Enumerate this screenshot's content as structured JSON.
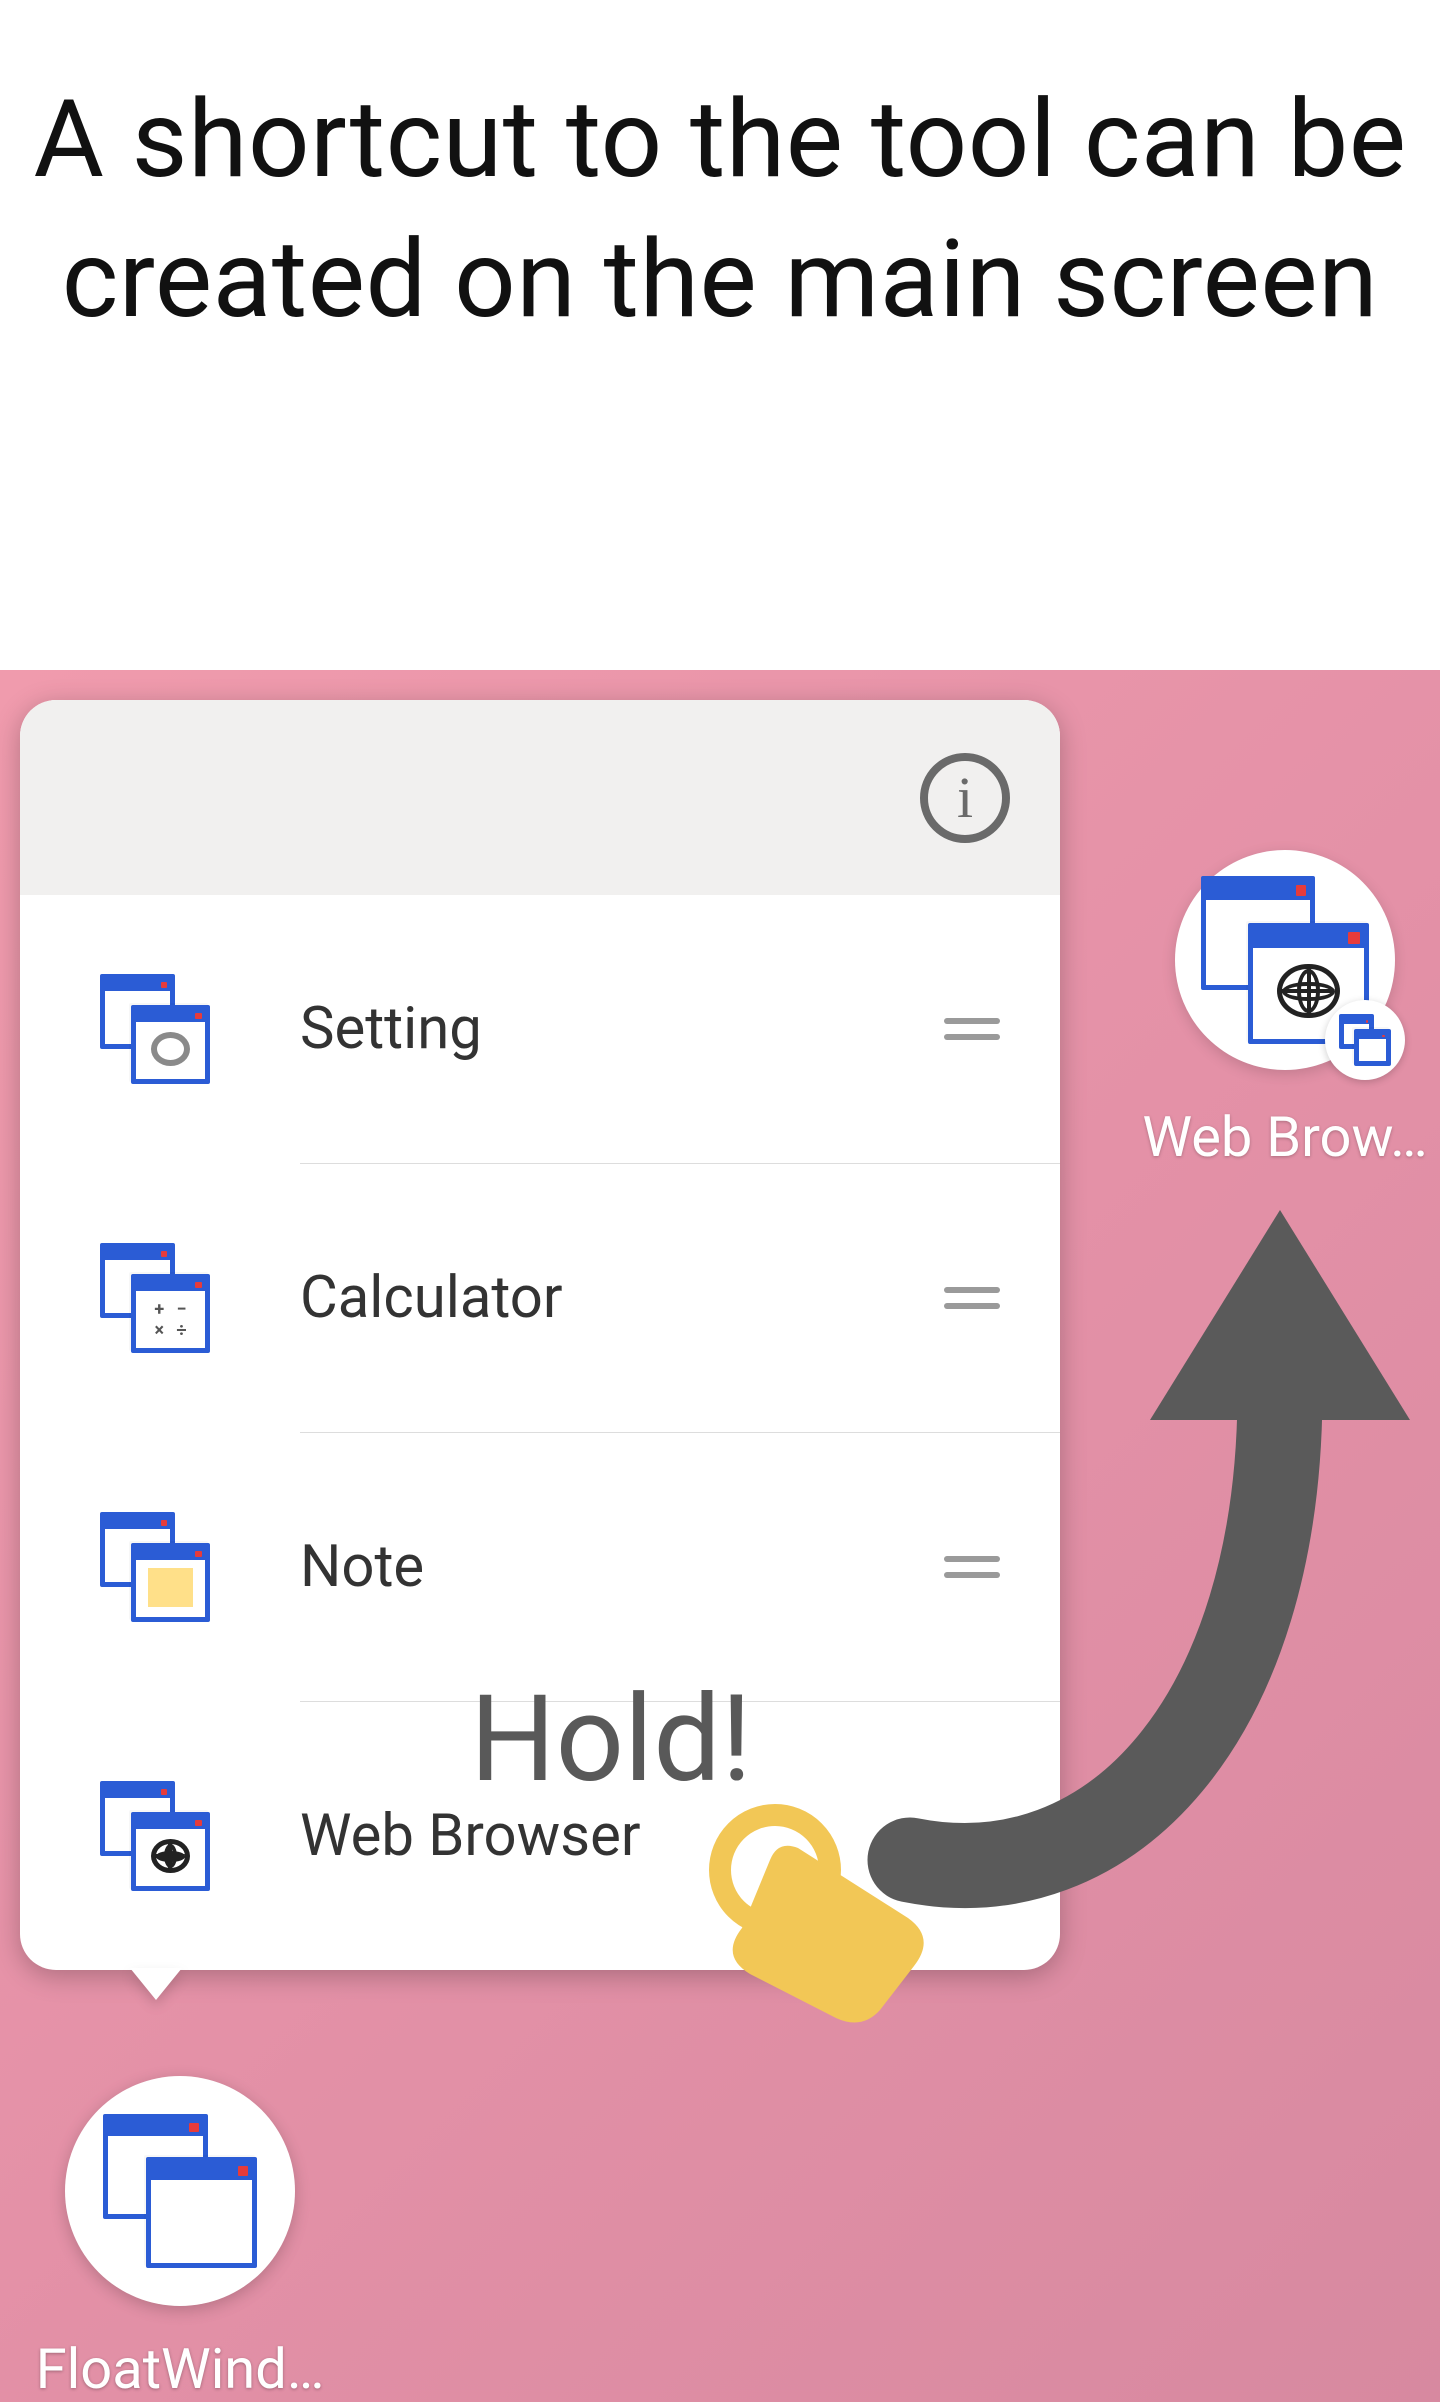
{
  "caption": "A shortcut to the tool can be created on the main screen",
  "panel": {
    "items": [
      {
        "label": "Setting",
        "glyph": "gear"
      },
      {
        "label": "Calculator",
        "glyph": "calc"
      },
      {
        "label": "Note",
        "glyph": "note"
      },
      {
        "label": "Web Browser",
        "glyph": "globe"
      }
    ]
  },
  "overlay": {
    "hold_label": "Hold!"
  },
  "shortcuts": {
    "browser_label": "Web Brow…",
    "float_label": "FloatWind…"
  },
  "info_char": "i"
}
